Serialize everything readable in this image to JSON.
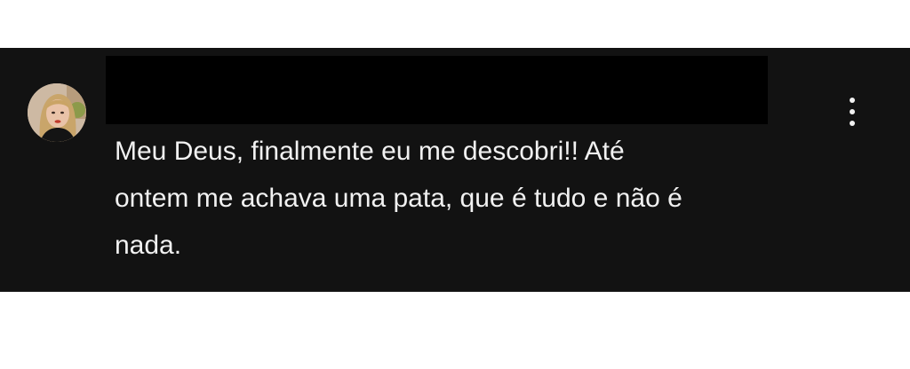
{
  "comment": {
    "author_name": "",
    "avatar_icon": "user-avatar-photo",
    "lines": [
      "Meu Deus, finalmente eu me descobri!! Até",
      "ontem me achava uma pata, que é tudo e não é",
      "nada."
    ],
    "menu_icon": "vertical-ellipsis-icon"
  },
  "colors": {
    "card_background": "#121212",
    "text": "#f1f1f1",
    "redaction": "#000000",
    "page_background": "#ffffff"
  }
}
